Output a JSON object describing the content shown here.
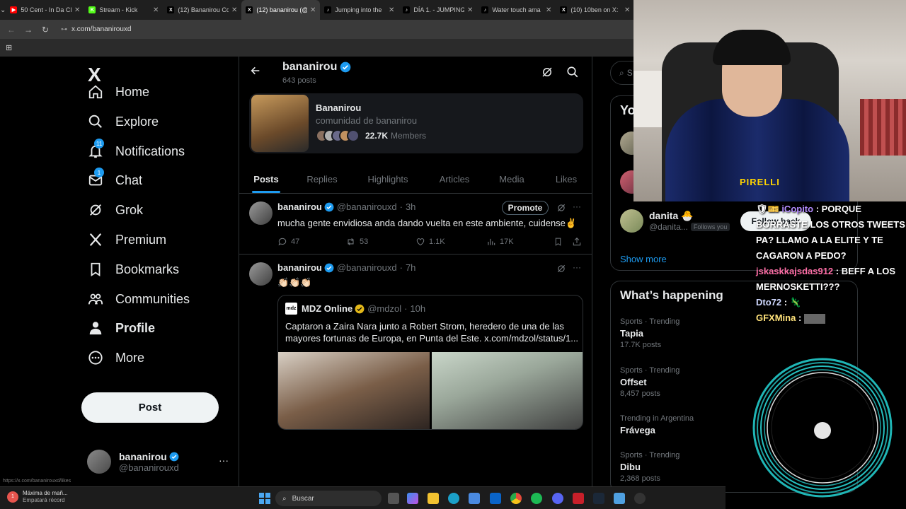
{
  "browser": {
    "tabs": [
      {
        "title": "50 Cent - In Da Cl",
        "color": "#ff0000",
        "glyph": "▶",
        "active": false
      },
      {
        "title": "Stream - Kick",
        "color": "#53fc18",
        "glyph": "K",
        "active": false
      },
      {
        "title": "(12) Bananirou Co",
        "color": "#000000",
        "glyph": "X",
        "active": false
      },
      {
        "title": "(12) bananirou (@",
        "color": "#000000",
        "glyph": "X",
        "active": true
      },
      {
        "title": "Jumping into the",
        "color": "#000000",
        "glyph": "♪",
        "active": false
      },
      {
        "title": "DÍA 1. - JUMPING",
        "color": "#000000",
        "glyph": "♪",
        "active": false
      },
      {
        "title": "Water touch ama",
        "color": "#000000",
        "glyph": "♪",
        "active": false
      },
      {
        "title": "(10) 10ben on X:",
        "color": "#000000",
        "glyph": "X",
        "active": false
      }
    ],
    "url": "x.com/bananirouxd",
    "status_url": "https://x.com/bananirouxd/likes"
  },
  "sidebar": {
    "logo": "X",
    "items": [
      {
        "label": "Home",
        "icon": "home-icon",
        "badge": ""
      },
      {
        "label": "Explore",
        "icon": "search-icon",
        "badge": ""
      },
      {
        "label": "Notifications",
        "icon": "bell-icon",
        "badge": "11"
      },
      {
        "label": "Chat",
        "icon": "mail-icon",
        "badge": "1"
      },
      {
        "label": "Grok",
        "icon": "grok-icon",
        "badge": ""
      },
      {
        "label": "Premium",
        "icon": "x-icon",
        "badge": ""
      },
      {
        "label": "Bookmarks",
        "icon": "bookmark-icon",
        "badge": ""
      },
      {
        "label": "Communities",
        "icon": "communities-icon",
        "badge": ""
      },
      {
        "label": "Profile",
        "icon": "person-icon",
        "badge": ""
      },
      {
        "label": "More",
        "icon": "more-circle-icon",
        "badge": ""
      }
    ],
    "post_label": "Post",
    "account": {
      "name": "bananirou",
      "handle": "@bananirouxd"
    }
  },
  "header": {
    "name": "bananirou",
    "posts_count": "643 posts"
  },
  "community": {
    "name": "Bananirou",
    "description": "comunidad de bananirou",
    "members_count": "22.7K",
    "members_label": "Members"
  },
  "profile_tabs": [
    "Posts",
    "Replies",
    "Highlights",
    "Articles",
    "Media",
    "Likes"
  ],
  "posts": [
    {
      "name": "bananirou",
      "handle": "@bananirouxd",
      "time": "3h",
      "text": "mucha gente envidiosa anda dando vuelta en este ambiente, cuidense✌️",
      "promote_label": "Promote",
      "replies": "47",
      "reposts": "53",
      "likes": "1.1K",
      "views": "17K"
    },
    {
      "name": "bananirou",
      "handle": "@bananirouxd",
      "time": "7h",
      "text": "👏🏻👏🏻👏🏻",
      "quote": {
        "logo": "mdz",
        "name": "MDZ Online",
        "handle": "@mdzol",
        "time": "10h",
        "text": "Captaron a Zaira Nara junto a Robert Strom, heredero de una de las mayores fortunas de Europa, en Punta del Este.  x.com/mdzol/status/1..."
      }
    }
  ],
  "right": {
    "search_placeholder": "S",
    "who_to_follow_title": "Yo",
    "suggestion": {
      "name": "danita 🐣",
      "handle": "@danita...",
      "follows_you": "Follows you",
      "button": "Follow back"
    },
    "show_more": "Show more",
    "whats_happening": "What’s happening",
    "trends": [
      {
        "context": "Sports · Trending",
        "name": "Tapia",
        "posts": "17.7K posts"
      },
      {
        "context": "Sports · Trending",
        "name": "Offset",
        "posts": "8,457 posts"
      },
      {
        "context": "Trending in Argentina",
        "name": "Frávega",
        "posts": ""
      },
      {
        "context": "Sports · Trending",
        "name": "Dibu",
        "posts": "2,368 posts"
      }
    ]
  },
  "webcam": {
    "shirt_text": "PIRELLI"
  },
  "chat": [
    {
      "user": "iCopito",
      "text": ": PORQUE BORRASTE LOS OTROS TWEETS PA? LLAMO A LA ELITE Y TE CAGARON A PEDO?"
    },
    {
      "user": "jskaskkajsdas912",
      "text": ": BEFF A LOS MERNOSKETTI???"
    },
    {
      "user": "Dto72",
      "text": ":"
    },
    {
      "user": "GFXMina",
      "text": ":"
    }
  ],
  "taskbar": {
    "weather_line1": "Máxima de mañ...",
    "weather_line2": "Empatará récord",
    "search_label": "Buscar",
    "notif_badge": "1"
  },
  "colors": {
    "accent": "#1d9bf0",
    "background": "#000000",
    "border": "#2f3336"
  }
}
